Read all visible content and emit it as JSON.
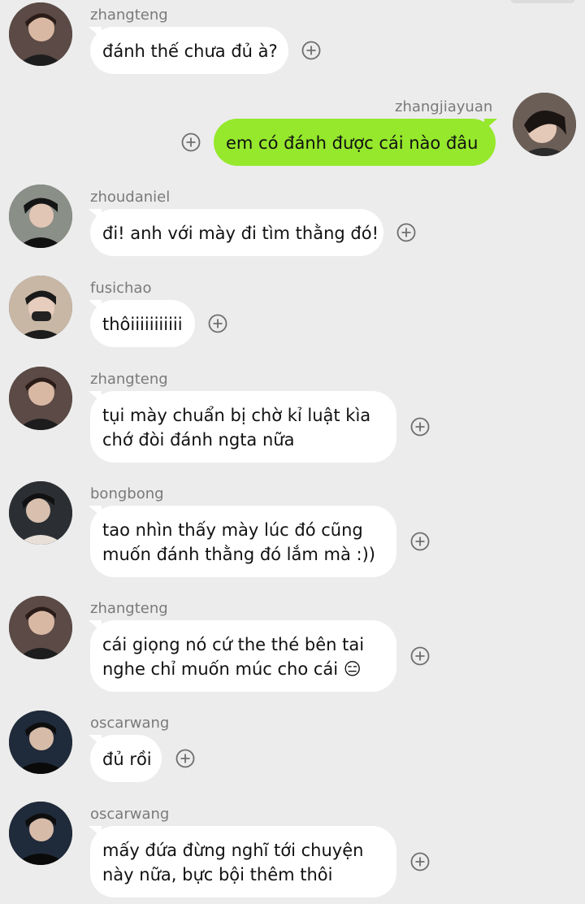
{
  "colors": {
    "background": "#ececec",
    "incoming_bubble": "#ffffff",
    "outgoing_bubble": "#95e82c",
    "name_text": "#7a7a7a"
  },
  "messages": [
    {
      "sender": "zhangteng",
      "side": "left",
      "lines": [
        "đánh thế chưa đủ à?"
      ]
    },
    {
      "sender": "zhangjiayuan",
      "side": "right",
      "lines": [
        "em có đánh được cái nào đâu"
      ]
    },
    {
      "sender": "zhoudaniel",
      "side": "left",
      "lines": [
        "đi! anh với mày đi tìm thằng đó!"
      ]
    },
    {
      "sender": "fusichao",
      "side": "left",
      "lines": [
        "thôiiiiiiiiiii"
      ]
    },
    {
      "sender": "zhangteng",
      "side": "left",
      "lines": [
        "tụi mày chuẩn bị chờ kỉ luật kìa",
        "chớ đòi đánh ngta nữa"
      ]
    },
    {
      "sender": "bongbong",
      "side": "left",
      "lines": [
        "tao nhìn thấy mày lúc đó cũng",
        "muốn đánh thằng đó lắm mà :))"
      ]
    },
    {
      "sender": "zhangteng",
      "side": "left",
      "lines": [
        "cái giọng nó cứ the thé bên tai",
        "nghe chỉ muốn múc cho cái 😑"
      ]
    },
    {
      "sender": "oscarwang",
      "side": "left",
      "lines": [
        "đủ rồi"
      ]
    },
    {
      "sender": "oscarwang",
      "side": "left",
      "lines": [
        "mấy đứa đừng nghĩ tới chuyện",
        "này nữa, bực bội thêm thôi"
      ]
    }
  ],
  "icons": {
    "add": "plus-circle-icon",
    "avatar": "avatar"
  }
}
